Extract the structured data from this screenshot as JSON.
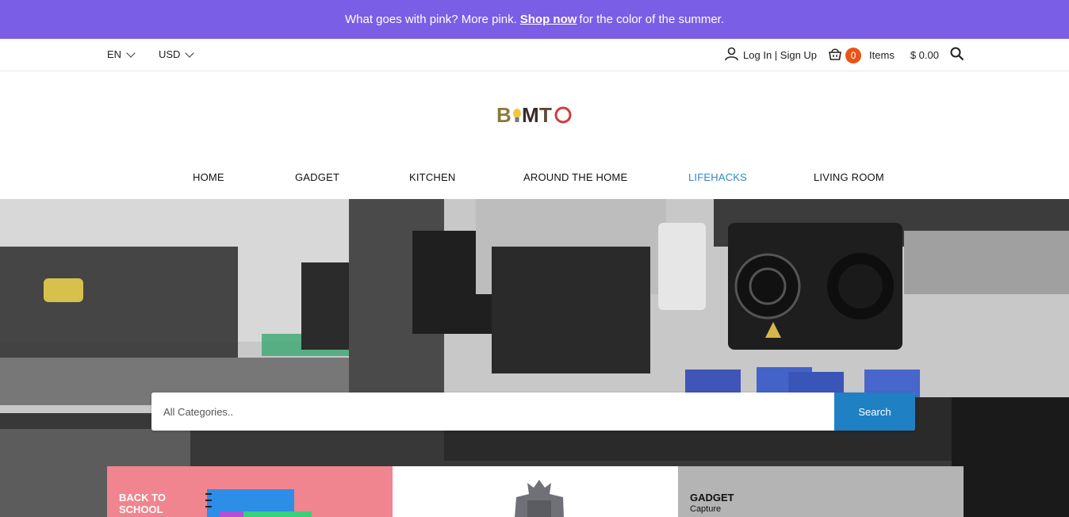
{
  "announcement": {
    "before": "What goes with pink? More pink.",
    "link": "Shop now",
    "after": "for the color of the summer."
  },
  "utility": {
    "language": "EN",
    "currency": "USD",
    "account_label": "Log In | Sign Up",
    "cart_count": "0",
    "cart_items_label": "Items",
    "cart_total": "$  0.00"
  },
  "logo": {
    "text": "BIMTO"
  },
  "nav": {
    "items": [
      {
        "label": "HOME"
      },
      {
        "label": "GADGET"
      },
      {
        "label": "KITCHEN"
      },
      {
        "label": "AROUND THE HOME"
      },
      {
        "label": "LIFEHACKS"
      },
      {
        "label": "LIVING ROOM"
      }
    ],
    "active_color": "#2f86c8"
  },
  "search": {
    "placeholder": "All Categories..",
    "button_label": "Search"
  },
  "cards": [
    {
      "title": "BACK TO SCHOOL",
      "subtitle": ""
    },
    {
      "title": "",
      "subtitle": ""
    },
    {
      "title": "GADGET",
      "subtitle": "Capture"
    }
  ],
  "colors": {
    "announcement_bg": "#7b5ee6",
    "badge": "#e8541a",
    "search_button": "#1f80c4",
    "card_pink": "#f0858f",
    "card_grey": "#b4b4b4"
  }
}
